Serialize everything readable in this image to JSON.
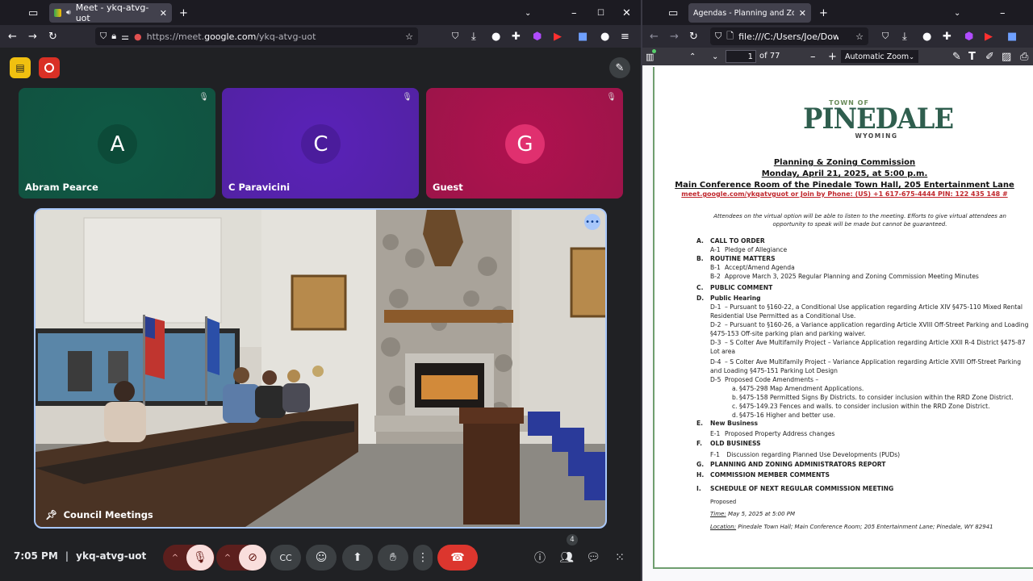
{
  "left_browser": {
    "tab_title": "Meet - ykq-atvg-uot",
    "url_prefix": "https://meet.",
    "url_domain": "google.com",
    "url_path": "/ykq-atvg-uot"
  },
  "meet": {
    "participants": [
      {
        "initial": "A",
        "name": "Abram Pearce",
        "bg": "#0f5a45",
        "avatar_bg": "#0c4a38"
      },
      {
        "initial": "C",
        "name": "C Paravicini",
        "bg": "#5a22b8",
        "avatar_bg": "#4b1c9c"
      },
      {
        "initial": "G",
        "name": "Guest",
        "bg": "#b0124f",
        "avatar_bg": "#e0306f"
      }
    ],
    "main_video_label": "Council Meetings",
    "time": "7:05 PM",
    "meeting_code": "ykq-atvg-uot",
    "people_count": "4",
    "icons": [
      "recording-icon",
      "record-icon",
      "edit-layout-icon",
      "mic-off-icon",
      "camera-off-icon",
      "captions-icon",
      "emoji-icon",
      "present-icon",
      "raise-hand-icon",
      "more-icon",
      "end-call-icon",
      "info-icon",
      "people-icon",
      "chat-icon",
      "activities-icon"
    ]
  },
  "right_browser": {
    "tab_title": "Agendas - Planning and Zoning Co",
    "url": "file:///C:/Users/Joe/Download",
    "page_number": "1",
    "page_total": "of 77",
    "zoom": "Automatic Zoom"
  },
  "document": {
    "logo_top": "TOWN OF",
    "logo_main": "PINEDALE",
    "logo_sub": "WYOMING",
    "title1": "Planning & Zoning Commission",
    "title2": "Monday, April 21, 2025, at 5:00 p.m.",
    "title3": "Main Conference Room of the Pinedale Town Hall, 205 Entertainment Lane",
    "join_line": "meet.google.com/ykqatvguot  or  Join by Phone: (US) +1 617-675-4444    PIN: 122 435 148 #",
    "notice": "Attendees on the virtual option will be able to listen to the meeting.  Efforts to give virtual attendees an opportunity to speak will be made but cannot be guaranteed.",
    "items": [
      {
        "k": "A.",
        "t": "CALL TO ORDER"
      },
      {
        "k": "A-1",
        "t": "Pledge of Allegiance"
      },
      {
        "k": "B.",
        "t": "ROUTINE MATTERS"
      },
      {
        "k": "B-1",
        "t": "Accept/Amend Agenda"
      },
      {
        "k": "B-2",
        "t": "Approve March 3, 2025 Regular Planning and Zoning Commission Meeting Minutes"
      },
      {
        "k": "C.",
        "t": "PUBLIC COMMENT"
      },
      {
        "k": "D.",
        "t": "Public Hearing"
      },
      {
        "k": "D-1",
        "t": "– Pursuant to §160-22, a Conditional Use application regarding Article XIV §475-110 Mixed Rental"
      },
      {
        "k": "",
        "t": "Residential Use Permitted as a Conditional Use."
      },
      {
        "k": "D-2",
        "t": "– Pursuant to §160-26, a Variance application regarding Article XVIII Off-Street Parking and Loading"
      },
      {
        "k": "",
        "t": "§475-153 Off-site parking plan and parking waiver."
      },
      {
        "k": "D-3",
        "t": "– S Colter Ave Multifamily Project – Variance Application regarding Article XXII R-4 District §475-87"
      },
      {
        "k": "",
        "t": "Lot area"
      },
      {
        "k": "D-4",
        "t": "– S Colter Ave Multifamily Project – Variance Application regarding Article XVIII Off-Street Parking"
      },
      {
        "k": "",
        "t": "and Loading §475-151 Parking Lot Design"
      },
      {
        "k": "D-5",
        "t": "Proposed Code Amendments –"
      },
      {
        "k": "a.",
        "t": "§475-298 Map Amendment Applications."
      },
      {
        "k": "b.",
        "t": "§475-158 Permitted Signs By Districts. to consider inclusion within the RRD Zone District."
      },
      {
        "k": "c.",
        "t": "§475-149.23 Fences and walls. to consider inclusion within the RRD Zone District."
      },
      {
        "k": "d.",
        "t": "§475-16 Higher and better use."
      },
      {
        "k": "E.",
        "t": "New Business"
      },
      {
        "k": "E-1",
        "t": "Proposed Property Address changes"
      },
      {
        "k": "F.",
        "t": "OLD BUSINESS"
      },
      {
        "k": "F-1",
        "t": " Discussion regarding Planned Use Developments (PUDs)"
      },
      {
        "k": "G.",
        "t": "PLANNING AND ZONING ADMINISTRATORS REPORT"
      },
      {
        "k": "H.",
        "t": "COMMISSION MEMBER COMMENTS"
      },
      {
        "k": "I.",
        "t": "SCHEDULE OF NEXT REGULAR COMMISSION MEETING"
      }
    ],
    "proposed": "Proposed",
    "time_label": "Time:",
    "time_value": " May 5, 2025 at 5:00 PM",
    "location_label": "Location:",
    "location_value": " Pinedale Town Hall; Main Conference Room; 205 Entertainment Lane; Pinedale, WY 82941"
  },
  "colors": {
    "accent_blue": "#a8c7fa",
    "end_call": "#dc362e",
    "muted_red": "#f9dedc",
    "logo_green": "#2f5e4e"
  }
}
